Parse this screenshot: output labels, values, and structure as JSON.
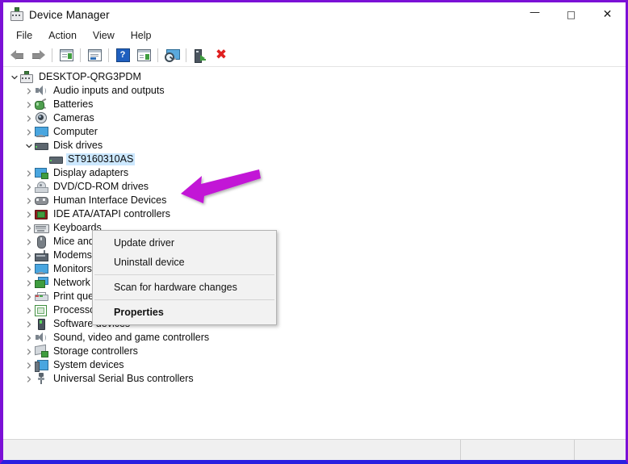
{
  "window": {
    "title": "Device Manager",
    "title_icon": "device-manager-icon",
    "controls": {
      "minimize": "—",
      "maximize": "□",
      "close": "✕"
    },
    "border_color_top": "#7b10d6",
    "border_color_bottom": "#2a20e0"
  },
  "menubar": {
    "items": [
      {
        "label": "File"
      },
      {
        "label": "Action"
      },
      {
        "label": "View"
      },
      {
        "label": "Help"
      }
    ]
  },
  "toolbar": {
    "buttons": [
      {
        "name": "back-button",
        "icon": "back-arrow-icon"
      },
      {
        "name": "forward-button",
        "icon": "forward-arrow-icon"
      },
      {
        "name": "show-hide-console-tree-button",
        "icon": "console-tree-icon"
      },
      {
        "name": "properties-button",
        "icon": "properties-window-icon"
      },
      {
        "name": "help-button",
        "icon": "question-mark-icon"
      },
      {
        "name": "update-driver-button",
        "icon": "update-driver-icon"
      },
      {
        "name": "scan-for-hardware-changes-button",
        "icon": "scan-monitor-icon"
      },
      {
        "name": "uninstall-device-button",
        "icon": "uninstall-device-icon"
      },
      {
        "name": "disable-device-button",
        "icon": "red-x-icon"
      }
    ]
  },
  "tree": {
    "root": {
      "label": "DESKTOP-QRG3PDM",
      "icon": "computer-node-icon",
      "expanded": true
    },
    "items": [
      {
        "label": "Audio inputs and outputs",
        "icon": "speaker-icon",
        "indent": 1,
        "expanded": false,
        "selected": false
      },
      {
        "label": "Batteries",
        "icon": "battery-icon",
        "indent": 1,
        "expanded": false,
        "selected": false
      },
      {
        "label": "Cameras",
        "icon": "camera-icon",
        "indent": 1,
        "expanded": false,
        "selected": false
      },
      {
        "label": "Computer",
        "icon": "monitor-icon",
        "indent": 1,
        "expanded": false,
        "selected": false
      },
      {
        "label": "Disk drives",
        "icon": "disk-drive-icon",
        "indent": 1,
        "expanded": true,
        "selected": false
      },
      {
        "label": "ST9160310AS",
        "icon": "disk-drive-icon",
        "indent": 2,
        "expanded": null,
        "selected": true
      },
      {
        "label": "Display adapters",
        "icon": "display-adapter-icon",
        "indent": 1,
        "expanded": false,
        "selected": false
      },
      {
        "label": "DVD/CD-ROM drives",
        "icon": "dvd-drive-icon",
        "indent": 1,
        "expanded": false,
        "selected": false
      },
      {
        "label": "Human Interface Devices",
        "icon": "gamepad-icon",
        "indent": 1,
        "expanded": false,
        "selected": false
      },
      {
        "label": "IDE ATA/ATAPI controllers",
        "icon": "ide-controller-icon",
        "indent": 1,
        "expanded": false,
        "selected": false
      },
      {
        "label": "Keyboards",
        "icon": "keyboard-icon",
        "indent": 1,
        "expanded": false,
        "selected": false
      },
      {
        "label": "Mice and other pointing devices",
        "icon": "mouse-icon",
        "indent": 1,
        "expanded": false,
        "selected": false
      },
      {
        "label": "Modems",
        "icon": "modem-icon",
        "indent": 1,
        "expanded": false,
        "selected": false
      },
      {
        "label": "Monitors",
        "icon": "monitor-icon",
        "indent": 1,
        "expanded": false,
        "selected": false
      },
      {
        "label": "Network adapters",
        "icon": "network-adapter-icon",
        "indent": 1,
        "expanded": false,
        "selected": false
      },
      {
        "label": "Print queues",
        "icon": "printer-icon",
        "indent": 1,
        "expanded": false,
        "selected": false
      },
      {
        "label": "Processors",
        "icon": "processor-icon",
        "indent": 1,
        "expanded": false,
        "selected": false
      },
      {
        "label": "Software devices",
        "icon": "software-device-icon",
        "indent": 1,
        "expanded": false,
        "selected": false
      },
      {
        "label": "Sound, video and game controllers",
        "icon": "speaker-icon",
        "indent": 1,
        "expanded": false,
        "selected": false
      },
      {
        "label": "Storage controllers",
        "icon": "storage-controller-icon",
        "indent": 1,
        "expanded": false,
        "selected": false
      },
      {
        "label": "System devices",
        "icon": "system-device-icon",
        "indent": 1,
        "expanded": false,
        "selected": false
      },
      {
        "label": "Universal Serial Bus controllers",
        "icon": "usb-controller-icon",
        "indent": 1,
        "expanded": false,
        "selected": false
      }
    ]
  },
  "context_menu": {
    "visible": true,
    "items": [
      {
        "label": "Update driver",
        "type": "item",
        "bold": false
      },
      {
        "label": "Uninstall device",
        "type": "item",
        "bold": false
      },
      {
        "type": "separator"
      },
      {
        "label": "Scan for hardware changes",
        "type": "item",
        "bold": false
      },
      {
        "type": "separator"
      },
      {
        "label": "Properties",
        "type": "item",
        "bold": true
      }
    ]
  },
  "annotation": {
    "arrow_color": "#c212d6",
    "points_to": "Uninstall device"
  },
  "statusbar": {
    "pane1": "",
    "pane2": "",
    "pane3": ""
  }
}
